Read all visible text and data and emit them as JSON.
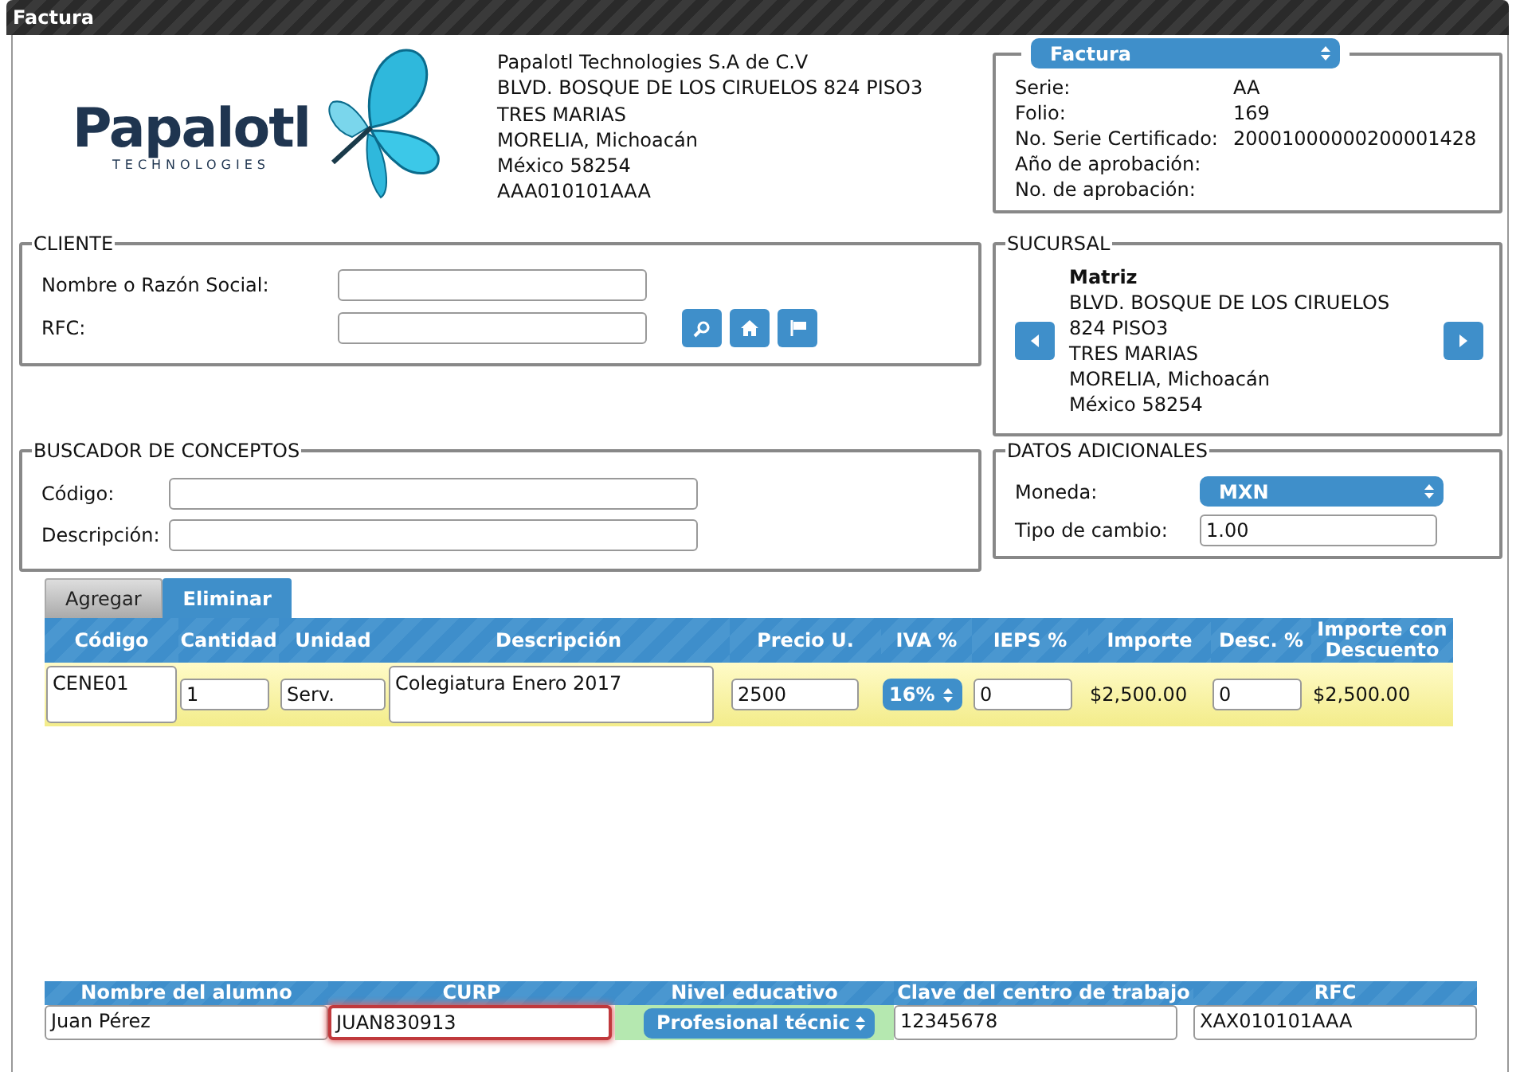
{
  "window": {
    "title": "Factura"
  },
  "company": {
    "logo_name": "Papalotl",
    "logo_tagline": "TECHNOLOGIES",
    "lines": [
      "Papalotl Technologies S.A de C.V",
      "BLVD. BOSQUE DE LOS CIRUELOS 824 PISO3",
      "TRES MARIAS",
      "MORELIA, Michoacán",
      "México 58254",
      "AAA010101AAA"
    ]
  },
  "factura": {
    "select": "Factura",
    "fields": [
      {
        "label": "Serie:",
        "value": "AA"
      },
      {
        "label": "Folio:",
        "value": "169"
      },
      {
        "label": "No. Serie Certificado:",
        "value": "20001000000200001428"
      },
      {
        "label": "Año de aprobación:"
      },
      {
        "label": "No. de aprobación:"
      }
    ]
  },
  "cliente": {
    "legend": "CLIENTE",
    "fields": [
      {
        "label": "Nombre o Razón Social:"
      },
      {
        "label": "RFC:"
      }
    ]
  },
  "sucursal": {
    "legend": "SUCURSAL",
    "name": "Matriz",
    "lines": [
      "BLVD. BOSQUE DE LOS CIRUELOS",
      "824 PISO3",
      "TRES MARIAS",
      "MORELIA, Michoacán",
      "México 58254"
    ]
  },
  "buscador": {
    "legend": "BUSCADOR DE CONCEPTOS",
    "fields": [
      {
        "label": "Código:"
      },
      {
        "label": "Descripción:"
      }
    ]
  },
  "datos_adicionales": {
    "legend": "DATOS ADICIONALES",
    "moneda_label": "Moneda:",
    "moneda": "MXN",
    "tipo_cambio_label": "Tipo de cambio:",
    "tipo_cambio": "1.00"
  },
  "tabs": [
    {
      "label": "Agregar",
      "selected": false
    },
    {
      "label": "Eliminar",
      "selected": true
    }
  ],
  "conceptos": {
    "columns": [
      "Código",
      "Cantidad",
      "Unidad",
      "Descripción",
      "Precio U.",
      "IVA %",
      "IEPS %",
      "Importe",
      "Desc. %",
      "Importe con Descuento"
    ],
    "rows": [
      {
        "selected": true,
        "cells": [
          {
            "kind": "input",
            "value": "CENE01"
          },
          {
            "kind": "input",
            "value": "1"
          },
          {
            "kind": "input",
            "value": "Serv."
          },
          {
            "kind": "input",
            "value": "Colegiatura Enero 2017"
          },
          {
            "kind": "input",
            "value": "2500"
          },
          {
            "kind": "select",
            "value": "16%"
          },
          {
            "kind": "input",
            "value": "0"
          },
          {
            "kind": "text",
            "value": "$2,500.00"
          },
          {
            "kind": "input",
            "value": "0"
          },
          {
            "kind": "text",
            "value": "$2,500.00"
          }
        ]
      }
    ]
  },
  "alumno": {
    "columns": [
      "Nombre del alumno",
      "CURP",
      "Nivel educativo",
      "Clave del centro de trabajo",
      "RFC"
    ],
    "cells": [
      {
        "kind": "input",
        "value": "Juan Pérez",
        "invalid": false,
        "valid": false
      },
      {
        "kind": "input",
        "value": "JUAN830913",
        "invalid": true,
        "valid": false
      },
      {
        "kind": "select",
        "value": "Profesional técnic",
        "invalid": false,
        "valid": true
      },
      {
        "kind": "input",
        "value": "12345678",
        "invalid": false,
        "valid": false
      },
      {
        "kind": "input",
        "value": "XAX010101AAA",
        "invalid": false,
        "valid": false
      }
    ]
  }
}
